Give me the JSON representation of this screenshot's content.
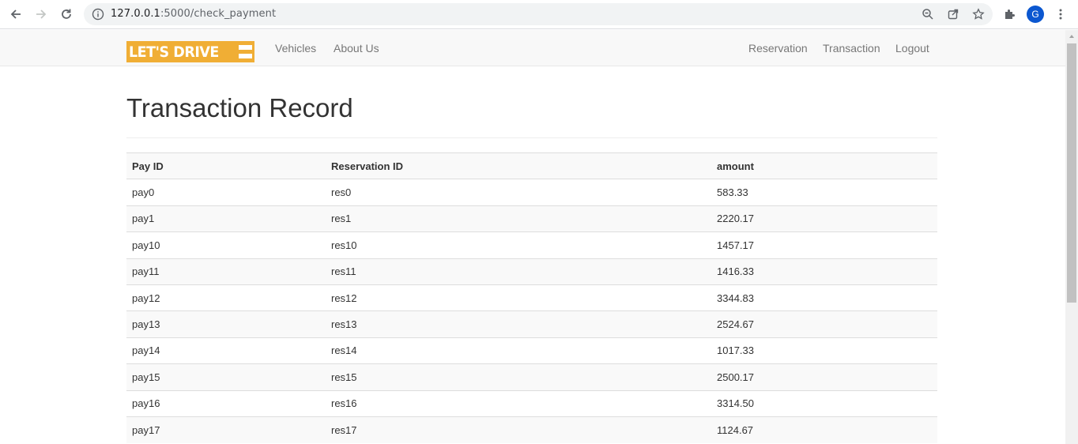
{
  "browser": {
    "url_host": "127.0.0.1",
    "url_path": ":5000/check_payment",
    "profile_initial": "G"
  },
  "navbar": {
    "brand": "LET'S DRIVE",
    "left_links": [
      "Vehicles",
      "About Us"
    ],
    "right_links": [
      "Reservation",
      "Transaction",
      "Logout"
    ]
  },
  "main": {
    "title": "Transaction Record",
    "columns": [
      "Pay ID",
      "Reservation ID",
      "amount"
    ],
    "rows": [
      [
        "pay0",
        "res0",
        "583.33"
      ],
      [
        "pay1",
        "res1",
        "2220.17"
      ],
      [
        "pay10",
        "res10",
        "1457.17"
      ],
      [
        "pay11",
        "res11",
        "1416.33"
      ],
      [
        "pay12",
        "res12",
        "3344.83"
      ],
      [
        "pay13",
        "res13",
        "2524.67"
      ],
      [
        "pay14",
        "res14",
        "1017.33"
      ],
      [
        "pay15",
        "res15",
        "2500.17"
      ],
      [
        "pay16",
        "res16",
        "3314.50"
      ],
      [
        "pay17",
        "res17",
        "1124.67"
      ]
    ]
  },
  "colors": {
    "brand_bg": "#f0ae35",
    "navbar_bg": "#f8f8f8",
    "nav_link": "#777777",
    "row_stripe": "#f9f9f9"
  }
}
